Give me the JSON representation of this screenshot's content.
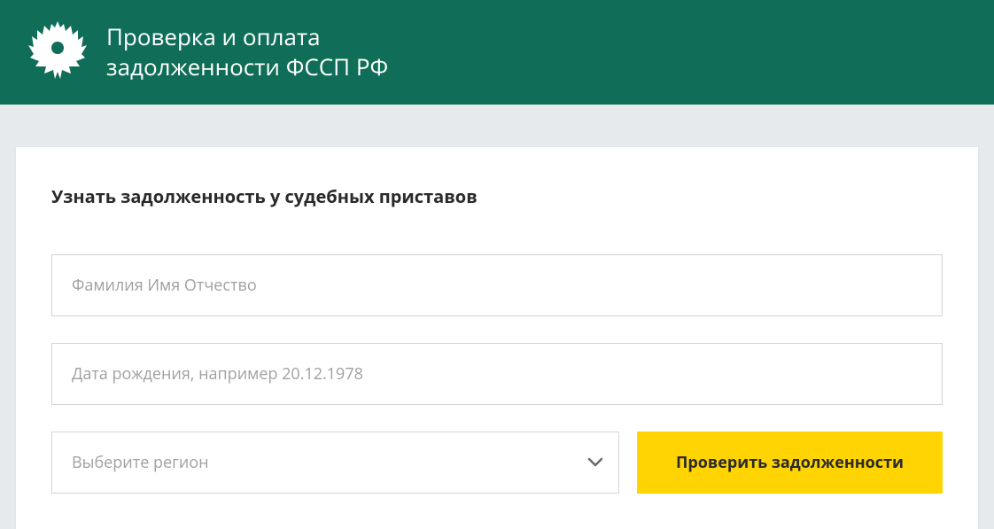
{
  "header": {
    "title_line1": "Проверка и оплата",
    "title_line2": "задолженности ФССП РФ"
  },
  "form": {
    "heading": "Узнать задолженность у судебных приставов",
    "name_placeholder": "Фамилия Имя Отчество",
    "name_value": "",
    "dob_placeholder": "Дата рождения, например 20.12.1978",
    "dob_value": "",
    "region_placeholder": "Выберите регион",
    "submit_label": "Проверить задолженности"
  },
  "colors": {
    "brand": "#106e58",
    "accent": "#ffd400",
    "page_bg": "#e6eaec"
  }
}
